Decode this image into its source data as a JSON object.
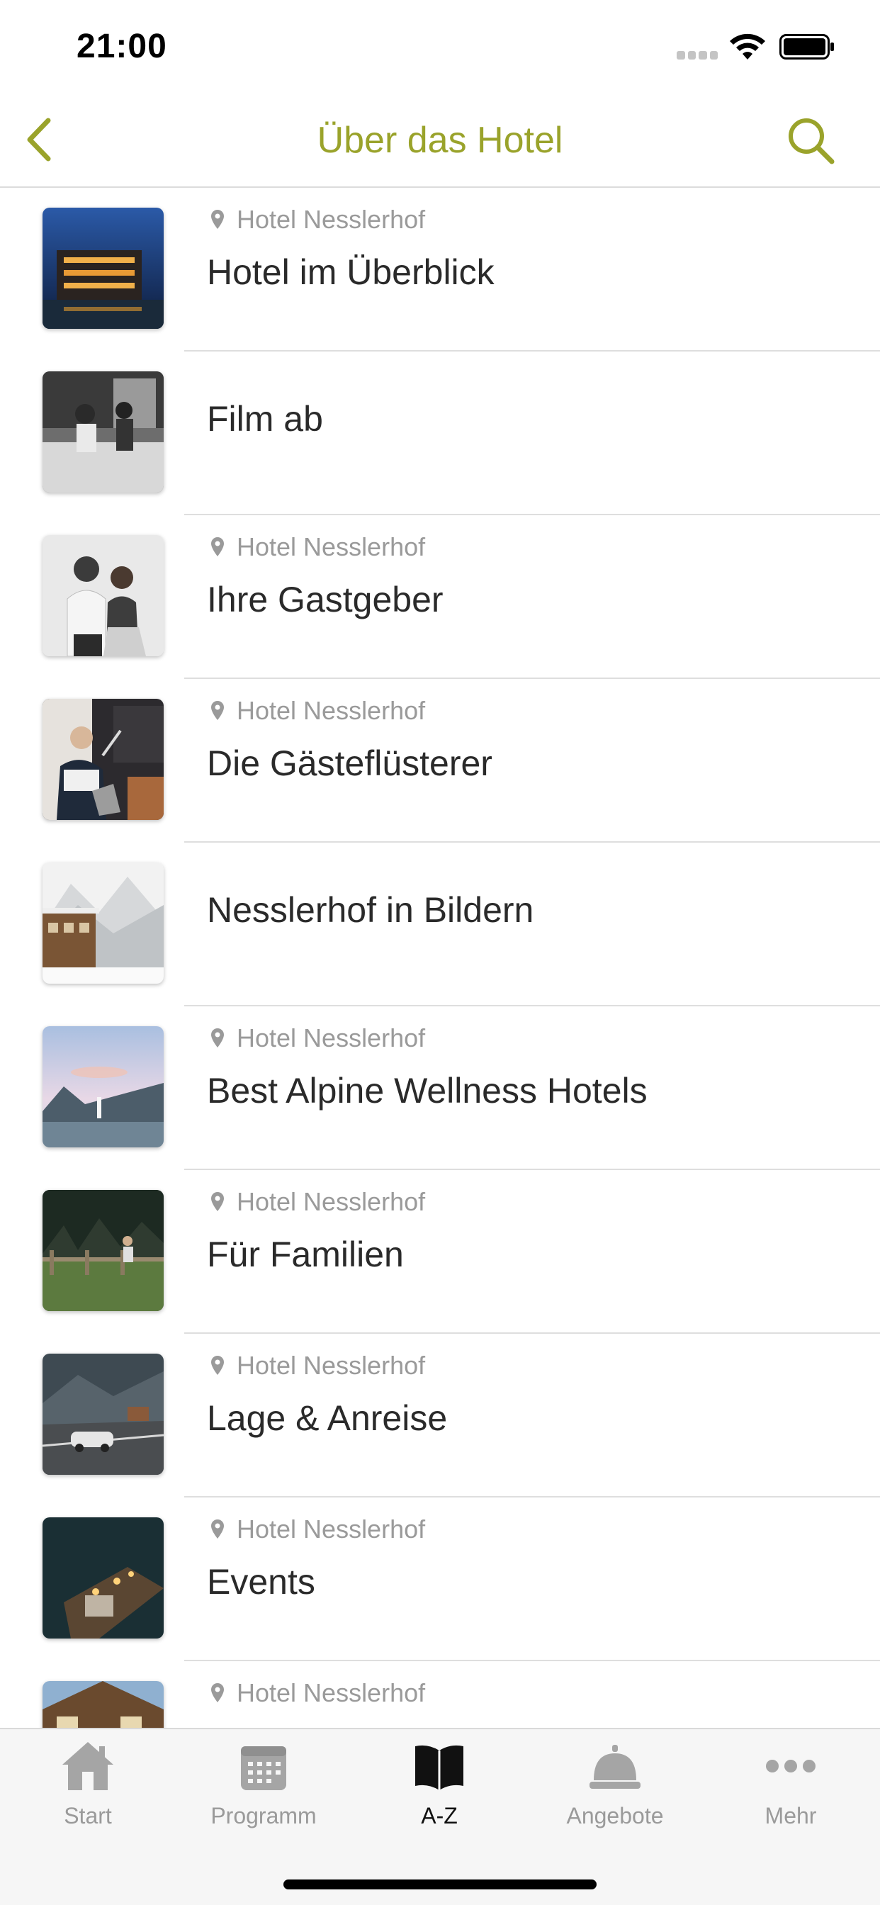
{
  "status": {
    "time": "21:00"
  },
  "nav": {
    "title": "Über das Hotel"
  },
  "items": [
    {
      "location": "Hotel Nesslerhof",
      "title": "Hotel im Überblick"
    },
    {
      "location": "",
      "title": "Film ab"
    },
    {
      "location": "Hotel Nesslerhof",
      "title": "Ihre Gastgeber"
    },
    {
      "location": "Hotel Nesslerhof",
      "title": "Die Gästeflüsterer"
    },
    {
      "location": "",
      "title": "Nesslerhof in Bildern"
    },
    {
      "location": "Hotel Nesslerhof",
      "title": "Best Alpine Wellness Hotels"
    },
    {
      "location": "Hotel Nesslerhof",
      "title": "Für Familien"
    },
    {
      "location": "Hotel Nesslerhof",
      "title": "Lage & Anreise"
    },
    {
      "location": "Hotel Nesslerhof",
      "title": "Events"
    },
    {
      "location": "Hotel Nesslerhof",
      "title": ""
    }
  ],
  "tabs": [
    {
      "label": "Start",
      "icon": "home-icon"
    },
    {
      "label": "Programm",
      "icon": "calendar-icon"
    },
    {
      "label": "A-Z",
      "icon": "book-icon",
      "active": true
    },
    {
      "label": "Angebote",
      "icon": "service-bell-icon"
    },
    {
      "label": "Mehr",
      "icon": "more-dots-icon"
    }
  ],
  "colors": {
    "accent": "#9aa32b",
    "secondary_text": "#9a9a9a",
    "tab_inactive": "#9a9a9a"
  }
}
